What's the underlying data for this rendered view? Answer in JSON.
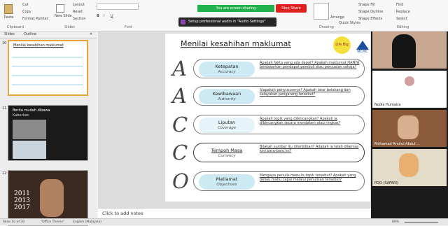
{
  "ribbon": {
    "paste": "Paste",
    "cut": "Cut",
    "copy": "Copy",
    "format_painter": "Format Painter",
    "new_slide": "New Slide",
    "layout": "Layout",
    "reset": "Reset",
    "section": "Section",
    "clipboard": "Clipboard",
    "slides": "Slides",
    "font": "Font",
    "drawing": "Drawing",
    "editing": "Editing",
    "arrange": "Arrange",
    "quick_styles": "Quick Styles",
    "shape_fill": "Shape Fill",
    "shape_outline": "Shape Outline",
    "shape_effects": "Shape Effects",
    "find": "Find",
    "replace": "Replace",
    "select": "Select",
    "sharing": "You are screen sharing",
    "stop_share": "Stop Share",
    "audio": "Setup professional audio in \"Audio Settings\""
  },
  "panel": {
    "tab_slides": "Slides",
    "tab_outline": "Outline"
  },
  "thumbs": [
    {
      "num": "10",
      "title": "Menilai kesahihan maklumat"
    },
    {
      "num": "11",
      "title": "Berita mudah dibawa",
      "sub": "Kaburkan"
    },
    {
      "num": "12",
      "years": "2011 2013 2017"
    }
  ],
  "slide": {
    "title": "Menilai kesahihan maklumat",
    "logo_text": "Life Big",
    "logo2_text": "MCMC",
    "rows": [
      {
        "letter": "A",
        "term": "Ketepatan",
        "en": "Accuracy",
        "q": "Apakah fakta yang ada dapat? Apakah maklumat HANYA berdasarkan pendapat pembuli atau penjualan sahaja?"
      },
      {
        "letter": "A",
        "term": "Kewibawaan",
        "en": "Authority",
        "q": "Siapakah penyusunnya? Apakah latar belakang dan kelayakan pengarang tersebut?"
      },
      {
        "letter": "C",
        "term": "Liputan",
        "en": "Coverage",
        "q": "Apakah topik yang dibincangkan? Apakah ia dibincangkan secara mendalam atau ringkas?"
      },
      {
        "letter": "C",
        "term": "Tempoh Masa",
        "en": "Currency",
        "q": "Bilakah sumber itu diterbitkan? Adakah ia telah dikemas kini baru-baru ini?"
      },
      {
        "letter": "O",
        "term": "Matlamat",
        "en": "Objectives",
        "q": "Mengapa penulis menulis topik tersebut? Apakah yang beliau mahu capai melalui penulisan tersebut?"
      }
    ]
  },
  "notes": "Click to add notes",
  "status": {
    "slide": "Slide 10 of 30",
    "theme": "\"Office Theme\"",
    "lang": "English (Malaysia)",
    "zoom": "89%"
  },
  "participants": [
    {
      "name": ""
    },
    {
      "name": "Nodia Humaira"
    },
    {
      "name": "Mohamad Amirul Abdul ..."
    },
    {
      "name": "PDO (SAFARI)"
    }
  ]
}
